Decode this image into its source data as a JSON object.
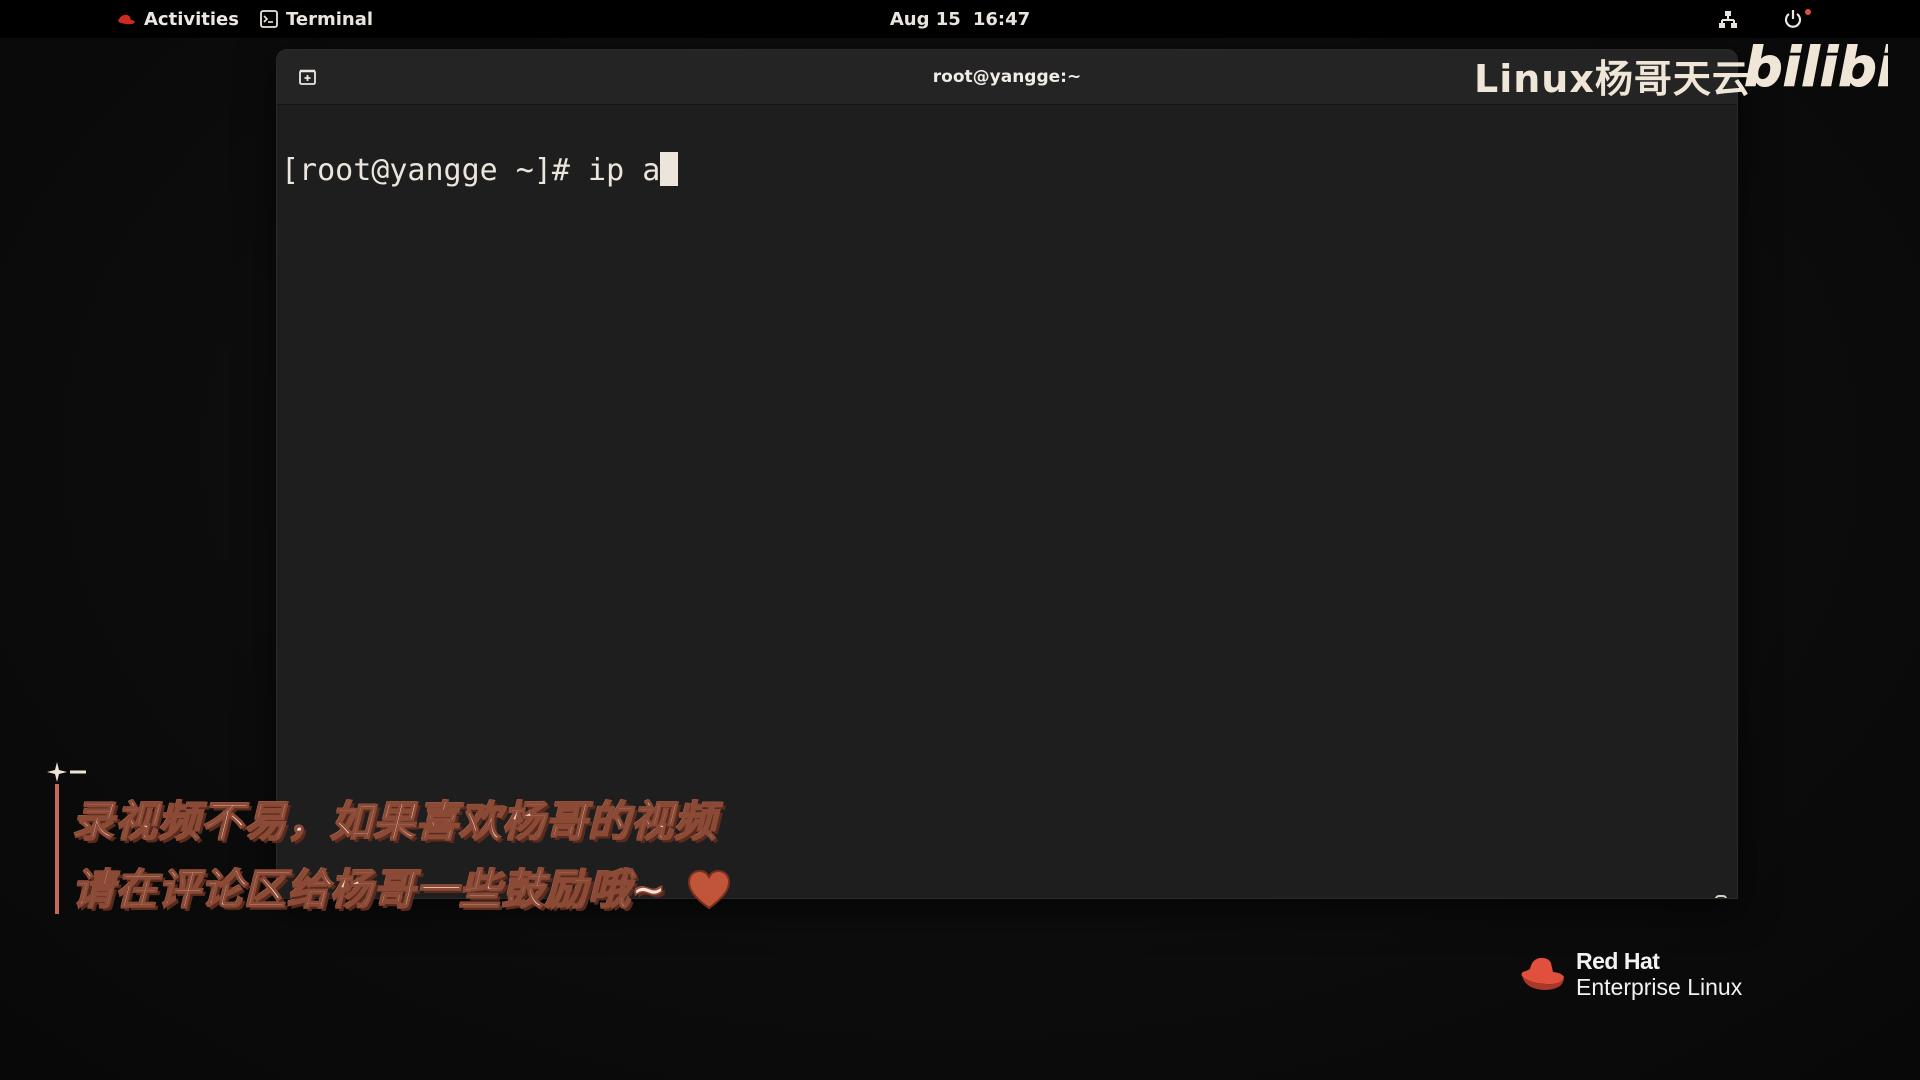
{
  "topbar": {
    "activities": "Activities",
    "app_name": "Terminal",
    "date": "Aug 15",
    "time": "16:47"
  },
  "terminal": {
    "title": "root@yangge:~",
    "prompt": "[root@yangge ~]# ",
    "command": "ip a"
  },
  "watermark": {
    "channel": "Linux杨哥天云",
    "logo": "bilibili"
  },
  "subtitle": {
    "line1": "录视频不易，如果喜欢杨哥的视频",
    "line2": "请在评论区给杨哥一些鼓励哦~"
  },
  "branding": {
    "brand": "Red Hat",
    "product": "Enterprise Linux"
  },
  "colors": {
    "accent_red": "#ee0000",
    "subtitle_fill": "#f6e0d3",
    "heart": "#c0553a",
    "terminal_bg": "#1e1e1e"
  }
}
